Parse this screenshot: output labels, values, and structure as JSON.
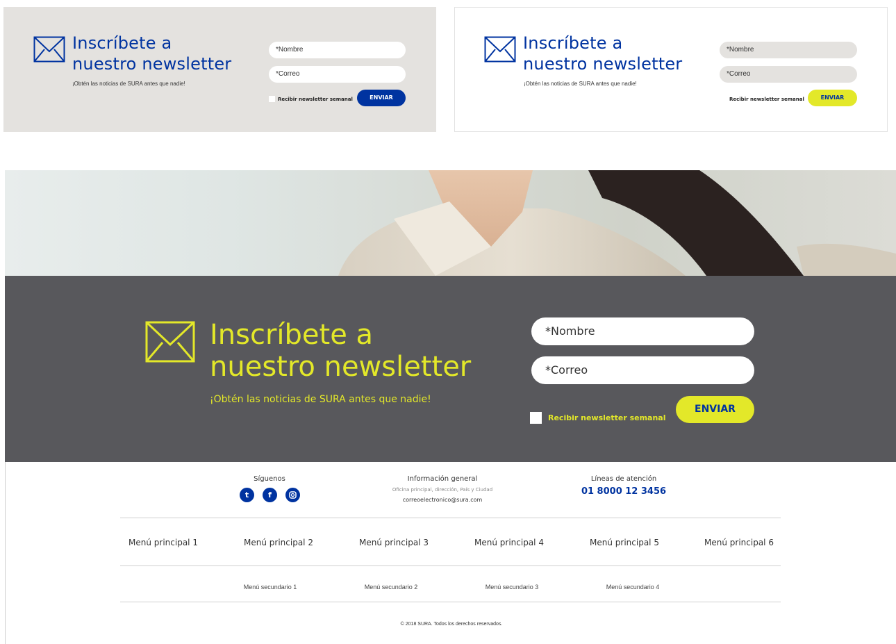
{
  "variant_gray": {
    "title_line1": "Inscríbete a",
    "title_line2": "nuestro newsletter",
    "subtitle": "¡Obtén las noticias de SURA antes que nadie!",
    "name_placeholder": "*Nombre",
    "email_placeholder": "*Correo",
    "checkbox_label": "Recibir newsletter semanal",
    "submit_label": "ENVIAR"
  },
  "variant_white": {
    "title_line1": "Inscríbete a",
    "title_line2": "nuestro newsletter",
    "subtitle": "¡Obtén las noticias de SURA antes que nadie!",
    "name_placeholder": "*Nombre",
    "email_placeholder": "*Correo",
    "checkbox_label": "Recibir newsletter semanal",
    "submit_label": "ENVIAR"
  },
  "variant_dark": {
    "title_line1": "Inscríbete a",
    "title_line2": "nuestro newsletter",
    "subtitle": "¡Obtén las noticias de SURA antes que nadie!",
    "name_placeholder": "*Nombre",
    "email_placeholder": "*Correo",
    "checkbox_label": "Recibir newsletter semanal",
    "submit_label": "ENVIAR"
  },
  "footer": {
    "follow_label": "Síguenos",
    "social_icons": [
      "twitter-icon",
      "facebook-icon",
      "instagram-icon"
    ],
    "info_title": "Información general",
    "info_address": "Oficina principal, dirección, País y Ciudad",
    "info_email": "correoelectronico@sura.com",
    "lines_title": "Líneas de atención",
    "phone": "01 8000 12 3456",
    "main_menu": [
      "Menú principal 1",
      "Menú principal 2",
      "Menú principal 3",
      "Menú principal 4",
      "Menú principal 5",
      "Menú principal 6"
    ],
    "secondary_menu": [
      "Menú secundario 1",
      "Menú secundario 2",
      "Menú secundario 3",
      "Menú secundario 4"
    ],
    "copyright": "© 2018 SURA. Todos los derechos reservados."
  },
  "colors": {
    "brand_blue": "#0033a0",
    "brand_yellow": "#e3e829",
    "dark_panel": "#58585c",
    "gray_panel": "#e4e2df"
  }
}
